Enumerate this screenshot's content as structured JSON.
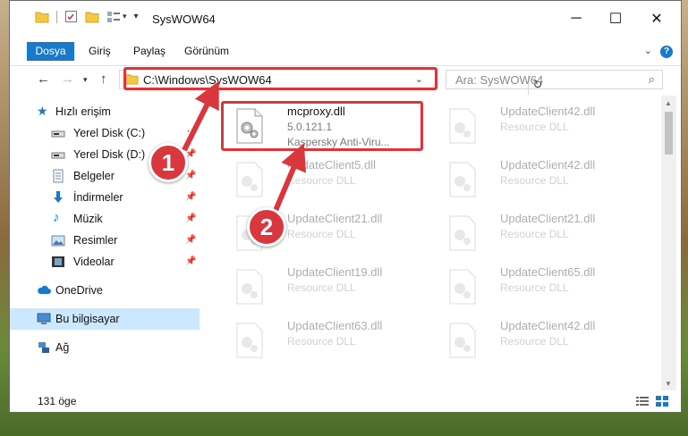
{
  "window": {
    "title": "SysWOW64",
    "controls": {
      "minimize": "─",
      "maximize": "☐",
      "close": "✕"
    }
  },
  "ribbon": {
    "tabs": [
      "Dosya",
      "Giriş",
      "Paylaş",
      "Görünüm"
    ],
    "help": "?"
  },
  "address": {
    "path": "C:\\Windows\\SysWOW64",
    "search_placeholder": "Ara: SysWOW64"
  },
  "sidebar": {
    "items": [
      {
        "label": "Hızlı erişim",
        "icon": "star-icon",
        "pinned": false
      },
      {
        "label": "Yerel Disk (C:)",
        "icon": "drive-icon",
        "pinned": true
      },
      {
        "label": "Yerel Disk (D:)",
        "icon": "drive-icon",
        "pinned": true
      },
      {
        "label": "Belgeler",
        "icon": "documents-icon",
        "pinned": true
      },
      {
        "label": "İndirmeler",
        "icon": "download-icon",
        "pinned": true
      },
      {
        "label": "Müzik",
        "icon": "music-icon",
        "pinned": true
      },
      {
        "label": "Resimler",
        "icon": "pictures-icon",
        "pinned": true
      },
      {
        "label": "Videolar",
        "icon": "video-icon",
        "pinned": true
      },
      {
        "label": "OneDrive",
        "icon": "cloud-icon",
        "pinned": false
      },
      {
        "label": "Bu bilgisayar",
        "icon": "computer-icon",
        "pinned": false,
        "selected": true
      },
      {
        "label": "Ağ",
        "icon": "network-icon",
        "pinned": false
      }
    ]
  },
  "files": [
    {
      "name": "mcproxy.dll",
      "line2": "5.0.121.1",
      "line3": "Kaspersky Anti-Viru...",
      "highlight": true
    },
    {
      "name": "UpdateClient42.dll",
      "line2": "Resource DLL",
      "line3": ""
    },
    {
      "name": "UpdateClient5.dll",
      "line2": "Resource DLL",
      "line3": ""
    },
    {
      "name": "UpdateClient42.dll",
      "line2": "Resource DLL",
      "line3": ""
    },
    {
      "name": "UpdateClient21.dll",
      "line2": "Resource DLL",
      "line3": ""
    },
    {
      "name": "UpdateClient21.dll",
      "line2": "Resource DLL",
      "line3": ""
    },
    {
      "name": "UpdateClient19.dll",
      "line2": "Resource DLL",
      "line3": ""
    },
    {
      "name": "UpdateClient65.dll",
      "line2": "Resource DLL",
      "line3": ""
    },
    {
      "name": "UpdateClient63.dll",
      "line2": "Resource DLL",
      "line3": ""
    },
    {
      "name": "UpdateClient42.dll",
      "line2": "Resource DLL",
      "line3": ""
    }
  ],
  "status": {
    "count": "131 öge"
  },
  "callouts": [
    "1",
    "2"
  ],
  "colors": {
    "accent": "#1979ca",
    "highlight": "#d9363e",
    "selection": "#cce8ff"
  }
}
